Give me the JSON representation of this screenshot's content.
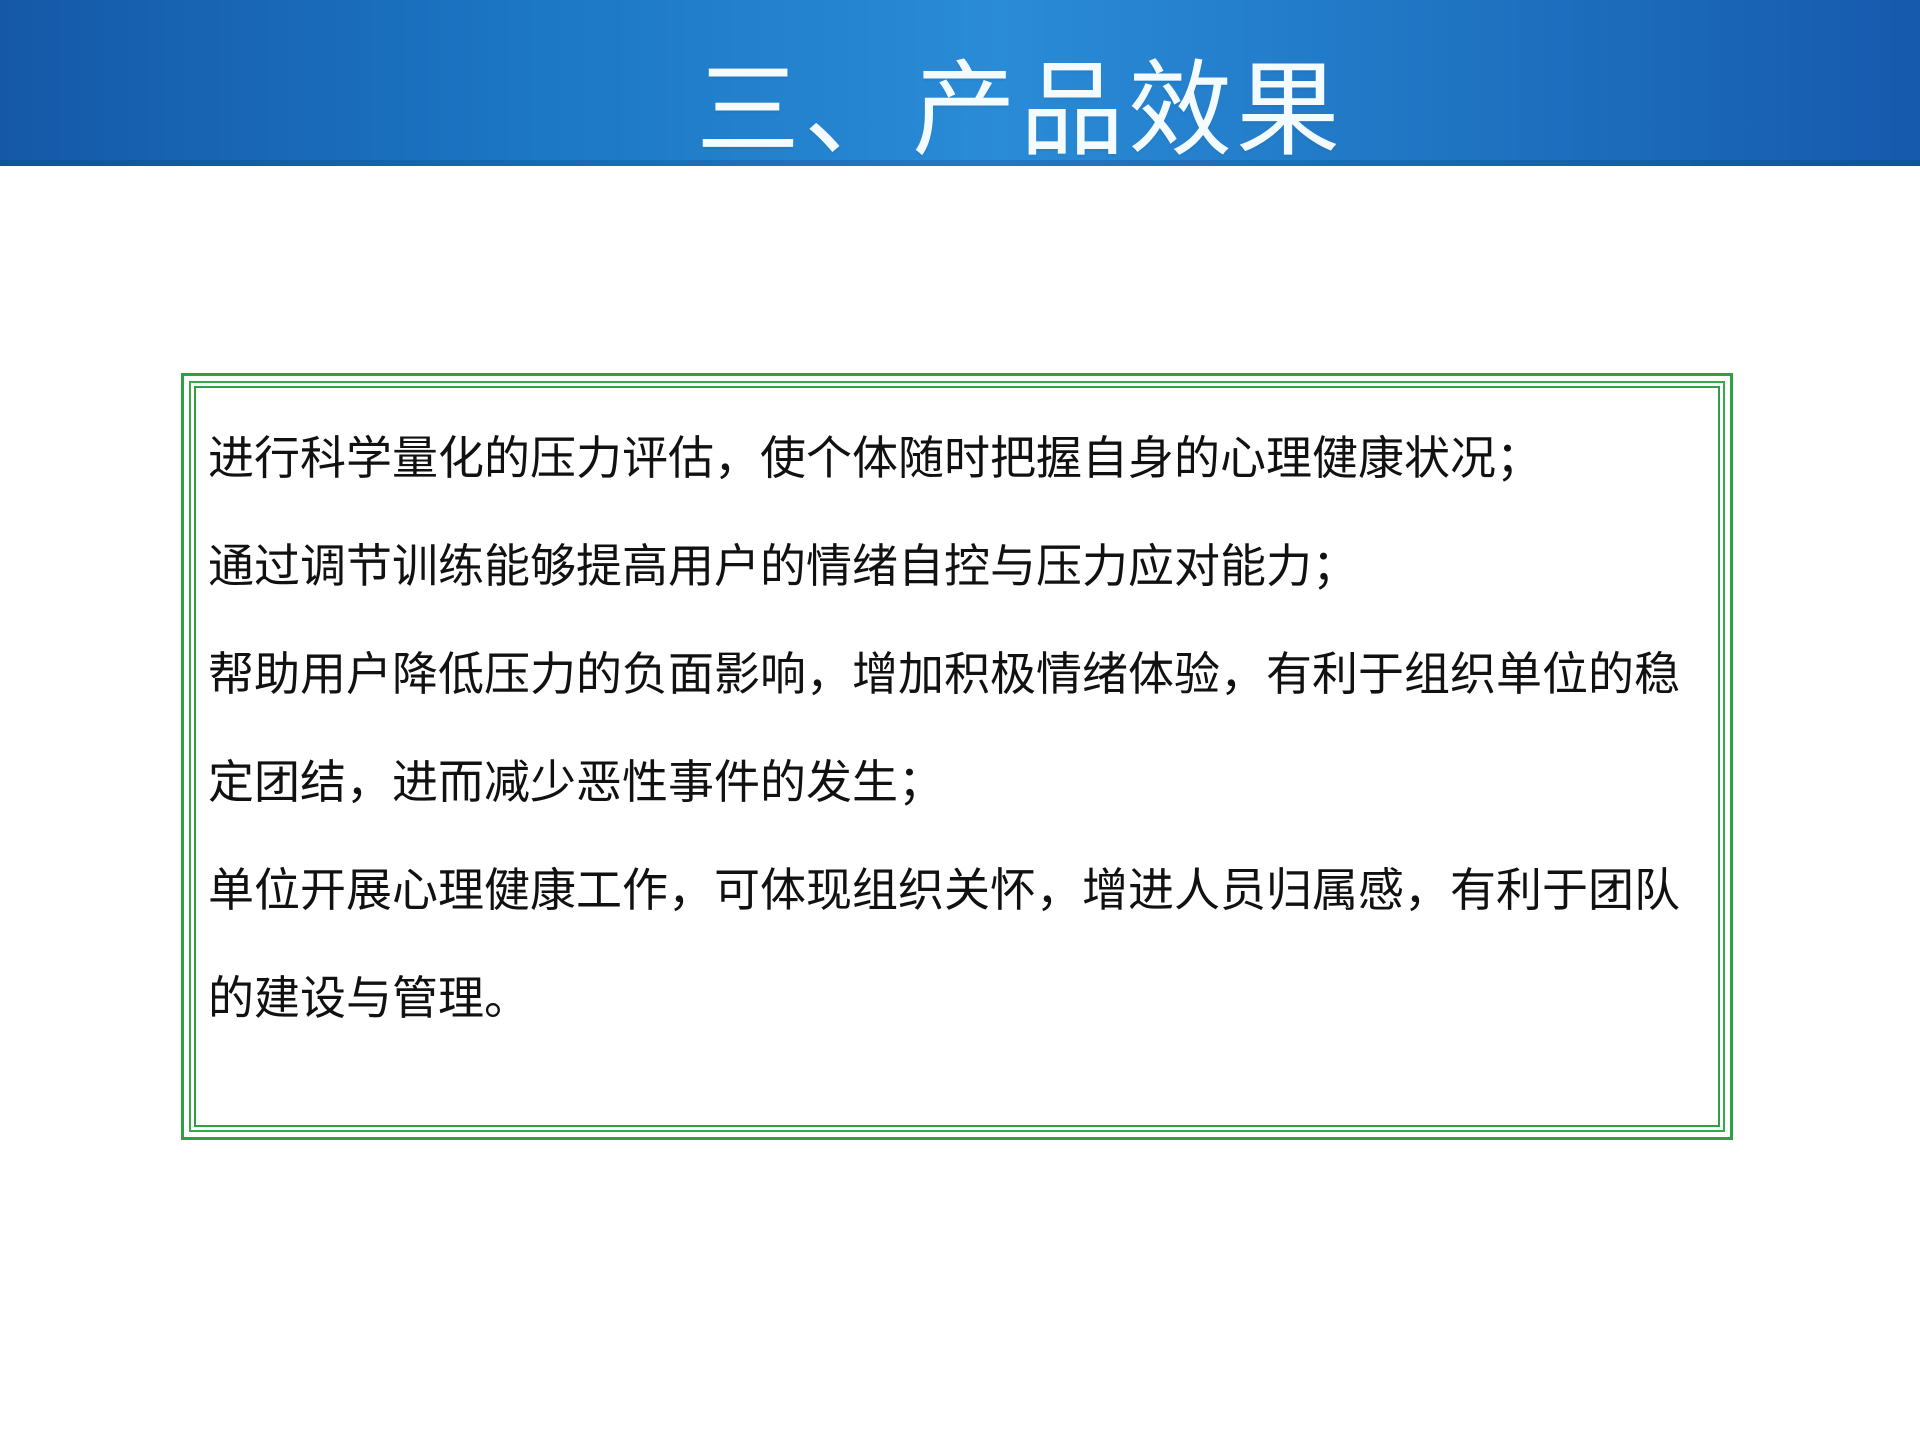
{
  "header": {
    "title": "三、产品效果"
  },
  "content": {
    "paragraphs": [
      "进行科学量化的压力评估，使个体随时把握自身的心理健康状况；",
      "通过调节训练能够提高用户的情绪自控与压力应对能力；",
      "帮助用户降低压力的负面影响，增加积极情绪体验，有利于组织单位的稳定团结，进而减少恶性事件的发生；",
      "单位开展心理健康工作，可体现组织关怀，增进人员归属感，有利于团队的建设与管理。"
    ]
  },
  "colors": {
    "header_blue": "#1c77c4",
    "border_green": "#2f9f43",
    "text": "#111111",
    "title_text": "#f4fbff"
  }
}
